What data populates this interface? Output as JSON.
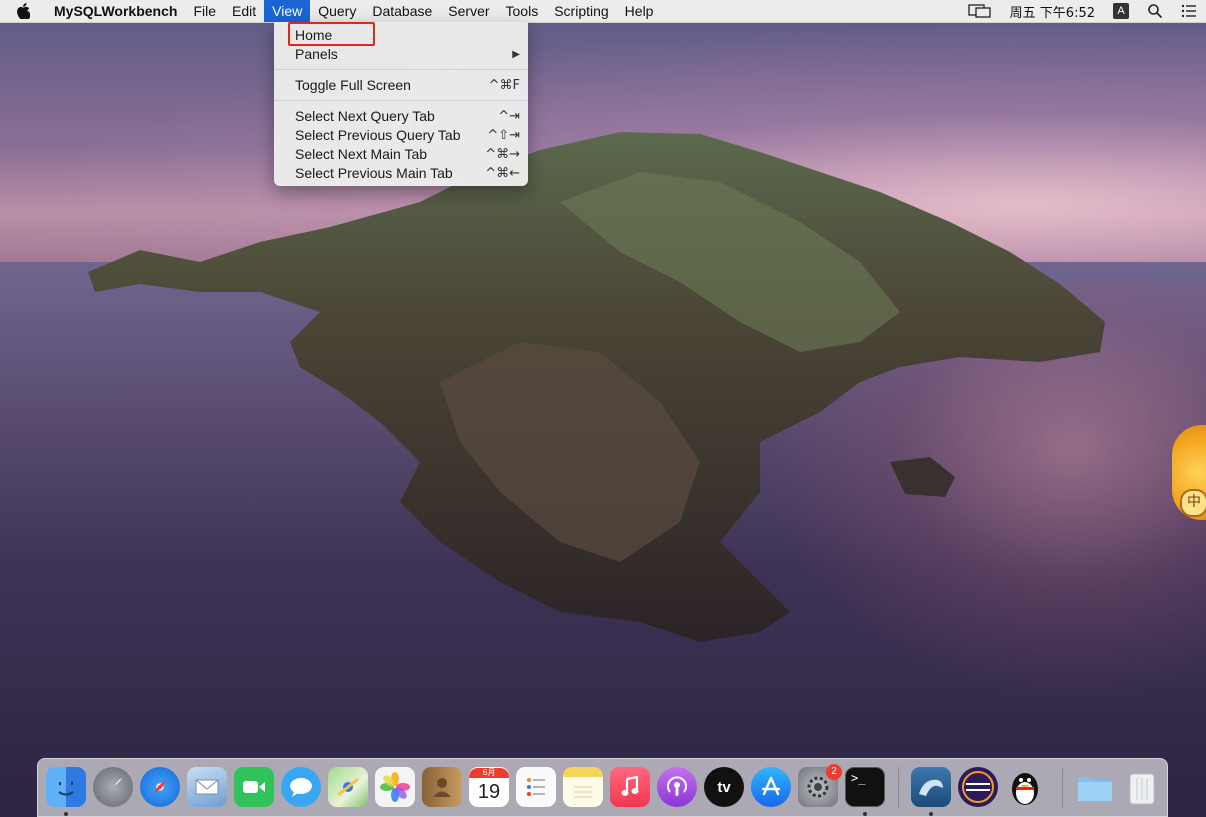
{
  "menubar": {
    "app_name": "MySQLWorkbench",
    "menus": [
      "File",
      "Edit",
      "View",
      "Query",
      "Database",
      "Server",
      "Tools",
      "Scripting",
      "Help"
    ],
    "active_menu": "View",
    "clock": "周五 下午6:52",
    "input_method": "A"
  },
  "view_menu": {
    "items": [
      {
        "label": "Home",
        "shortcut": ""
      },
      {
        "label": "Panels",
        "shortcut": "▶"
      },
      {
        "label": "Toggle Full Screen",
        "shortcut": "^⌘F"
      },
      {
        "label": "Select Next Query Tab",
        "shortcut": "^⇥"
      },
      {
        "label": "Select Previous Query Tab",
        "shortcut": "^⇧⇥"
      },
      {
        "label": "Select Next Main Tab",
        "shortcut": "^⌘→"
      },
      {
        "label": "Select Previous Main Tab",
        "shortcut": "^⌘←"
      }
    ]
  },
  "side_widget": {
    "char": "中"
  },
  "dock": {
    "apps": [
      {
        "name": "Finder",
        "icon": "finder-icon",
        "color": "#3a8ef5"
      },
      {
        "name": "Launchpad",
        "icon": "rocket-icon",
        "color": "#7b8089"
      },
      {
        "name": "Safari",
        "icon": "compass-icon",
        "color": "#2b8ff0"
      },
      {
        "name": "Mail",
        "icon": "mail-icon",
        "color": "#6fa4d6"
      },
      {
        "name": "FaceTime",
        "icon": "video-icon",
        "color": "#2fc35a"
      },
      {
        "name": "Messages",
        "icon": "chat-icon",
        "color": "#37a7f4"
      },
      {
        "name": "Maps",
        "icon": "map-icon",
        "color": "#7cc46a"
      },
      {
        "name": "Photos",
        "icon": "photos-icon",
        "color": "#f3f3f3"
      },
      {
        "name": "Contacts",
        "icon": "contacts-icon",
        "color": "#b58a5a"
      },
      {
        "name": "Calendar",
        "icon": "calendar-icon",
        "color": "#ffffff",
        "month": "6月",
        "day": "19"
      },
      {
        "name": "Reminders",
        "icon": "list-icon",
        "color": "#f7f7f7"
      },
      {
        "name": "Notes",
        "icon": "notes-icon",
        "color": "#f6d45a"
      },
      {
        "name": "Music",
        "icon": "music-icon",
        "color": "#f5455d"
      },
      {
        "name": "Podcasts",
        "icon": "podcast-icon",
        "color": "#9b4ee0"
      },
      {
        "name": "TV",
        "icon": "tv-icon",
        "color": "#111111",
        "label": "tv"
      },
      {
        "name": "App Store",
        "icon": "appstore-icon",
        "color": "#1e8cf7"
      },
      {
        "name": "System Preferences",
        "icon": "gear-icon",
        "color": "#8c8f94",
        "badge": "2"
      },
      {
        "name": "Terminal",
        "icon": "terminal-icon",
        "color": "#111111"
      },
      {
        "name": "MySQL Workbench",
        "icon": "dolphin-icon",
        "color": "#2a5d8f"
      },
      {
        "name": "Eclipse",
        "icon": "eclipse-icon",
        "color": "#2b1b5c"
      },
      {
        "name": "QQ",
        "icon": "penguin-icon",
        "color": "#ffffff"
      },
      {
        "name": "Downloads",
        "icon": "folder-icon",
        "color": "#7cc1f2"
      },
      {
        "name": "Trash",
        "icon": "trash-icon",
        "color": "#e6e8ea"
      }
    ]
  }
}
